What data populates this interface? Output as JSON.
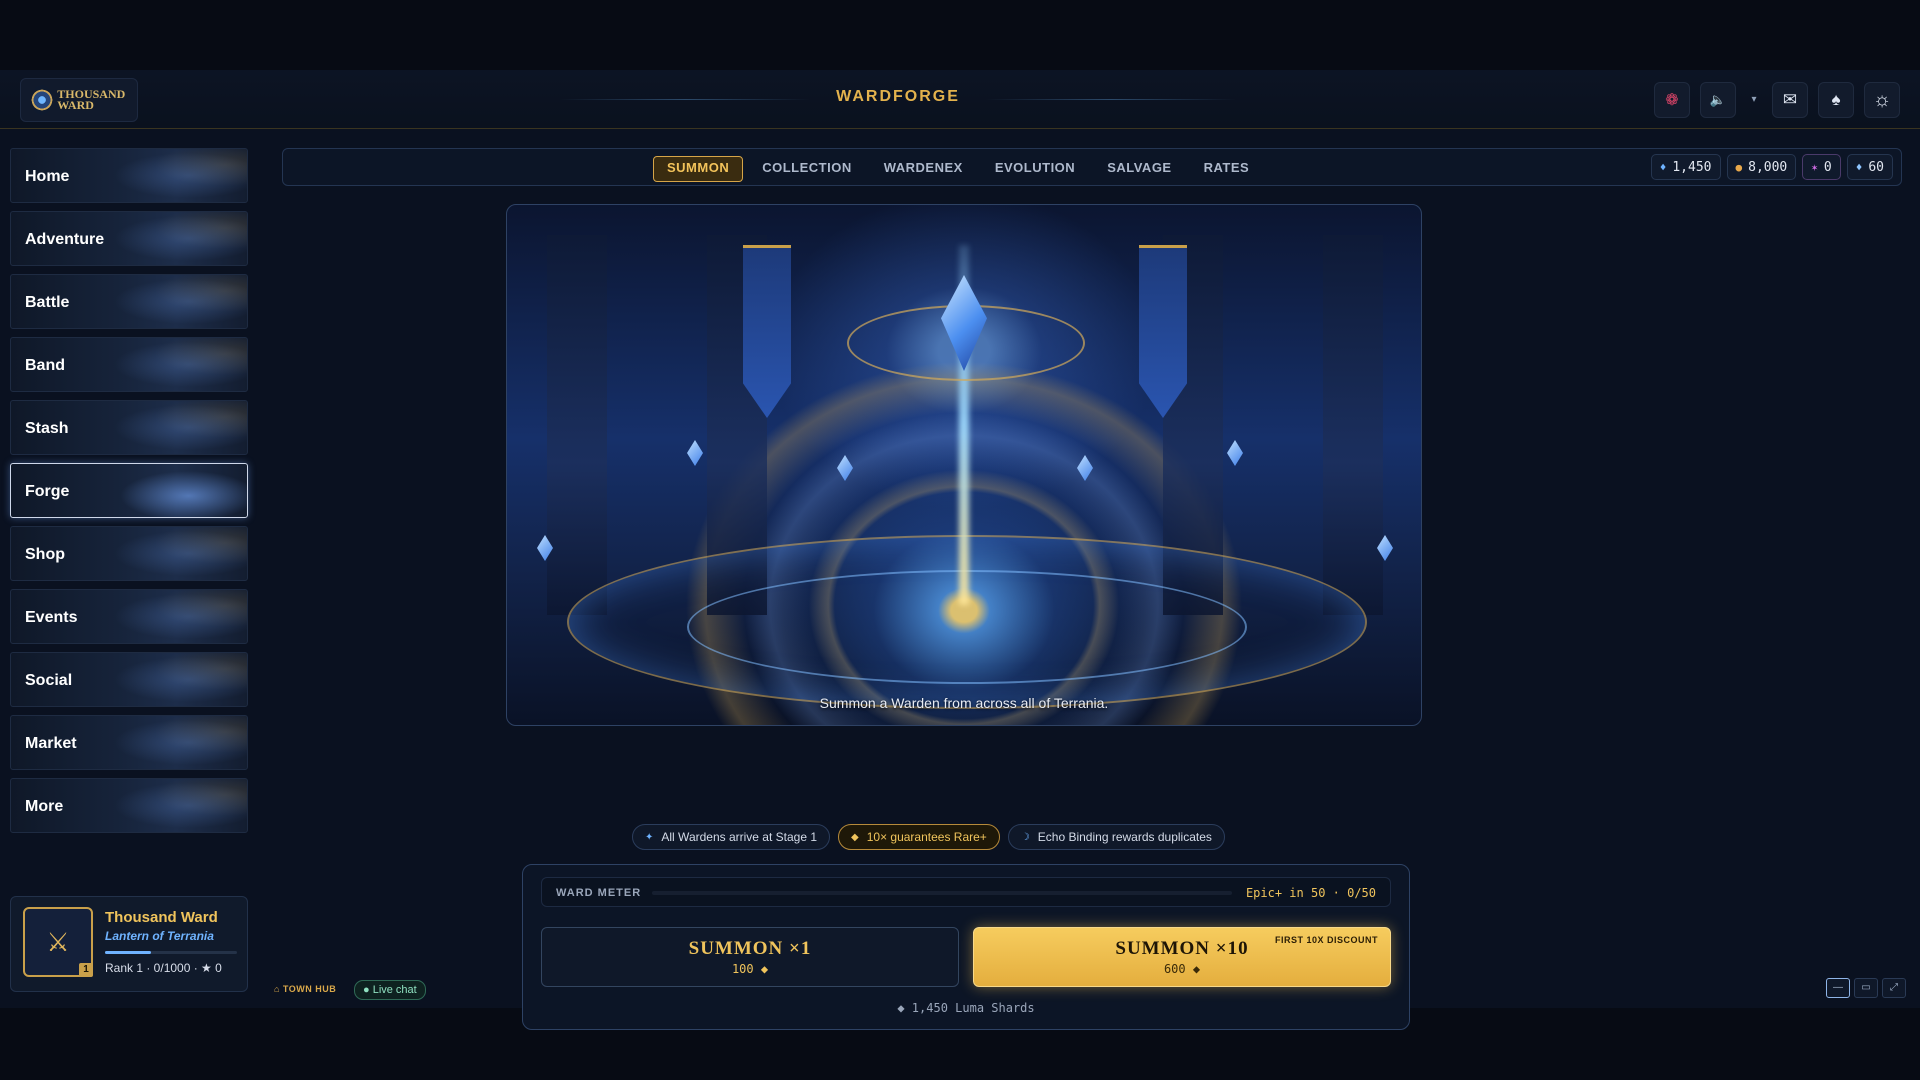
{
  "app": {
    "logo_text": "THOUSAND WARD",
    "title": "WARDFORGE"
  },
  "top_icons": [
    {
      "name": "alert-icon",
      "glyph": "❁"
    },
    {
      "name": "volume-icon",
      "glyph": "🔈"
    },
    {
      "name": "chevron-down-icon",
      "glyph": "▾"
    },
    {
      "name": "mail-icon",
      "glyph": "✉"
    },
    {
      "name": "bell-icon",
      "glyph": "♠"
    },
    {
      "name": "settings-icon",
      "glyph": "☼"
    }
  ],
  "sidebar": {
    "items": [
      {
        "label": "Home"
      },
      {
        "label": "Adventure"
      },
      {
        "label": "Battle"
      },
      {
        "label": "Band"
      },
      {
        "label": "Stash"
      },
      {
        "label": "Forge",
        "active": true
      },
      {
        "label": "Shop"
      },
      {
        "label": "Events"
      },
      {
        "label": "Social"
      },
      {
        "label": "Market"
      },
      {
        "label": "More"
      }
    ]
  },
  "profile": {
    "name": "Thousand Ward",
    "subtitle": "Lantern of Terrania",
    "rank": "Rank 1 · 0/1000 · ★ 0",
    "level_badge": "1",
    "xp_progress": 0.35
  },
  "tabs": [
    {
      "label": "SUMMON",
      "active": true
    },
    {
      "label": "COLLECTION"
    },
    {
      "label": "WARDENEX"
    },
    {
      "label": "EVOLUTION"
    },
    {
      "label": "SALVAGE"
    },
    {
      "label": "RATES"
    }
  ],
  "currencies": [
    {
      "icon": "luma-shard-icon",
      "glyph": "♦",
      "value": "1,450",
      "color": "#6fb3ff"
    },
    {
      "icon": "gold-coin-icon",
      "glyph": "●",
      "value": "8,000",
      "color": "#e8a84a"
    },
    {
      "icon": "star-shard-icon",
      "glyph": "✶",
      "value": "0",
      "color": "#d46fe8"
    },
    {
      "icon": "energy-icon",
      "glyph": "♦",
      "value": "60",
      "color": "#8fc6ff"
    }
  ],
  "hero": {
    "caption": "Summon a Warden from across all of Terrania."
  },
  "chips": [
    {
      "icon": "✦",
      "text": "All Wardens arrive at Stage 1"
    },
    {
      "icon": "◆",
      "text": "10× guarantees Rare+",
      "highlight": true
    },
    {
      "icon": "☽",
      "text": "Echo Binding rewards duplicates"
    }
  ],
  "ward_meter": {
    "label": "WARD METER",
    "status": "Epic+ in 50 · 0/50",
    "progress": 0
  },
  "summon_single": {
    "title": "SUMMON ×1",
    "cost": "100 ◆"
  },
  "summon_multi": {
    "title": "SUMMON ×10",
    "cost": "600 ◆",
    "badge": "FIRST 10X DISCOUNT"
  },
  "balance": "◆ 1,450 Luma Shards",
  "footer": {
    "town_hub": "⌂ TOWN HUB",
    "live_chat": "● Live chat",
    "window_controls": [
      "—",
      "▭",
      "⤢"
    ]
  }
}
